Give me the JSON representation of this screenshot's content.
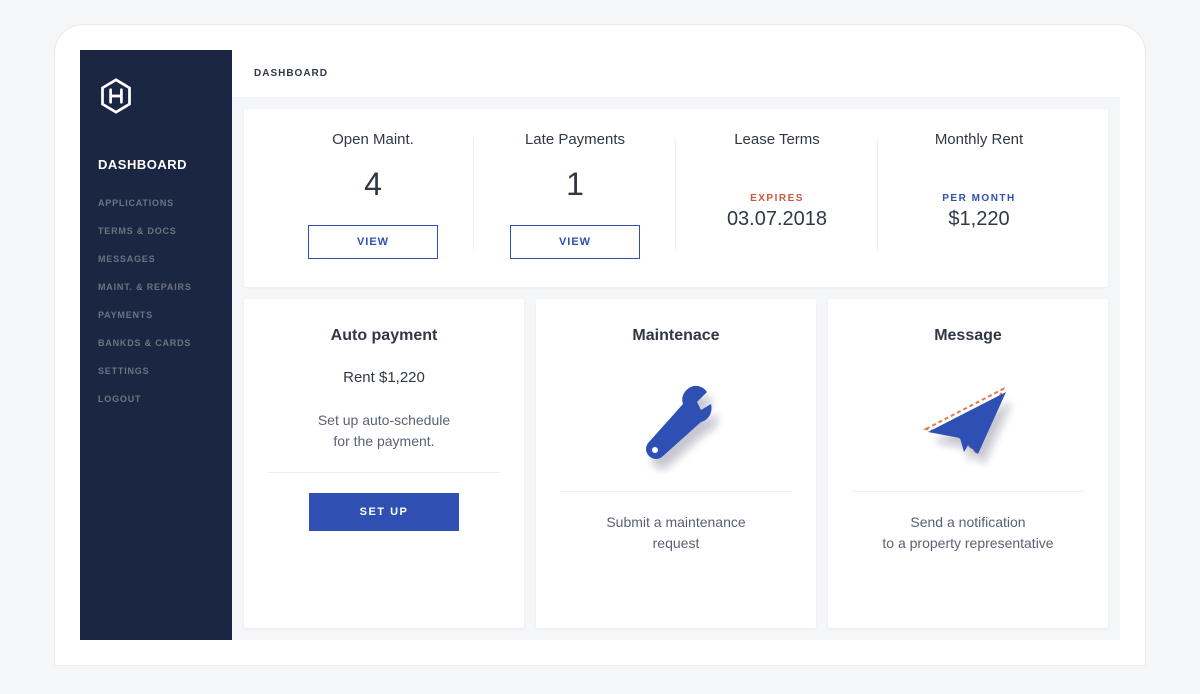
{
  "sidebar": {
    "items": [
      {
        "label": "DASHBOARD",
        "active": true
      },
      {
        "label": "APPLICATIONS"
      },
      {
        "label": "TERMS & DOCS"
      },
      {
        "label": "MESSAGES"
      },
      {
        "label": "MAINT. & REPAIRS"
      },
      {
        "label": "PAYMENTS"
      },
      {
        "label": "BANKDS & CARDS"
      },
      {
        "label": "SETTINGS"
      },
      {
        "label": "LOGOUT"
      }
    ]
  },
  "topbar": {
    "title": "DASHBOARD"
  },
  "stats": {
    "open_maint": {
      "label": "Open Maint.",
      "value": "4",
      "button": "VIEW"
    },
    "late_payments": {
      "label": "Late Payments",
      "value": "1",
      "button": "VIEW"
    },
    "lease_terms": {
      "label": "Lease Terms",
      "caption": "EXPIRES",
      "value": "03.07.2018"
    },
    "monthly_rent": {
      "label": "Monthly Rent",
      "caption": "PER MONTH",
      "value": "$1,220"
    }
  },
  "cards": {
    "auto_payment": {
      "title": "Auto payment",
      "rent": "Rent $1,220",
      "desc_line1": "Set up auto-schedule",
      "desc_line2": "for the payment.",
      "button": "SET UP"
    },
    "maintenance": {
      "title": "Maintenace",
      "action_line1": "Submit a maintenance",
      "action_line2": "request"
    },
    "message": {
      "title": "Message",
      "action_line1": "Send a notification",
      "action_line2": "to a property representative"
    }
  }
}
